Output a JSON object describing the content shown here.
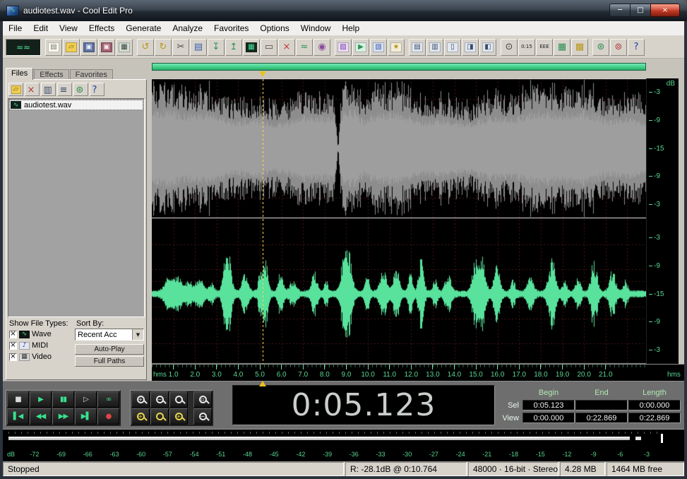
{
  "window": {
    "title": "audiotest.wav - Cool Edit Pro",
    "icon_glyph": "∿",
    "controls": {
      "minimize": "─",
      "maximize": "□",
      "close": "×"
    }
  },
  "menu": {
    "items": [
      "File",
      "Edit",
      "View",
      "Effects",
      "Generate",
      "Analyze",
      "Favorites",
      "Options",
      "Window",
      "Help"
    ]
  },
  "toolbar": {
    "groups": [
      {
        "buttons": [
          {
            "name": "waveform-multitrack-toggle",
            "glyph": "≈≈",
            "fg": "#45e096",
            "bg": "#14211a",
            "fs": 12,
            "wide": true
          }
        ]
      },
      {
        "buttons": [
          {
            "name": "new-file",
            "glyph": "▤",
            "fg": "#77756b",
            "bg": "#fcfcf0"
          },
          {
            "name": "open-file",
            "glyph": "▱",
            "fg": "#7c5f0e",
            "bg": "#f0ce52"
          },
          {
            "name": "save-file",
            "glyph": "▣",
            "fg": "#e8ecf8",
            "bg": "#5e6f9e"
          },
          {
            "name": "save-as-file",
            "glyph": "▣",
            "fg": "#f8e8ec",
            "bg": "#9e5e6f"
          },
          {
            "name": "file-info",
            "glyph": "▦",
            "fg": "#37423a",
            "bg": "#d4ddd4"
          }
        ]
      },
      {
        "buttons": [
          {
            "name": "undo",
            "glyph": "↺",
            "fg": "#b8981c"
          },
          {
            "name": "redo",
            "glyph": "↻",
            "fg": "#b8981c"
          },
          {
            "name": "cut",
            "glyph": "✂",
            "fg": "#4a4a4a"
          },
          {
            "name": "copy",
            "glyph": "▤",
            "fg": "#3a5fae"
          },
          {
            "name": "paste",
            "glyph": "↧",
            "fg": "#2e8f54"
          },
          {
            "name": "paste-to-new",
            "glyph": "↥",
            "fg": "#2e8f54"
          },
          {
            "name": "mix-paste",
            "glyph": "▦",
            "fg": "#45e096",
            "bg": "#142a1c"
          },
          {
            "name": "trim",
            "glyph": "▭",
            "fg": "#4a4a4a"
          },
          {
            "name": "delete-selection",
            "glyph": "×",
            "fg": "#c03a3a"
          },
          {
            "name": "convert-sample-type",
            "glyph": "≈",
            "fg": "#2e8f54"
          },
          {
            "name": "find-beats",
            "glyph": "◉",
            "fg": "#8a4a9e"
          }
        ]
      },
      {
        "buttons": [
          {
            "name": "effects-rack",
            "glyph": "▨",
            "fg": "#7a3fae",
            "bg": "#e9dcf4"
          },
          {
            "name": "preview-play",
            "glyph": "▶",
            "fg": "#2e8f54",
            "bg": "#d9f0e2"
          },
          {
            "name": "batch-scripts",
            "glyph": "▧",
            "fg": "#3a5fae",
            "bg": "#dae2f2"
          },
          {
            "name": "favorites-edit",
            "glyph": "★",
            "fg": "#b8981c",
            "bg": "#f4eed8"
          }
        ]
      },
      {
        "buttons": [
          {
            "name": "cue-list",
            "glyph": "▤",
            "fg": "#3a4a6b",
            "bg": "#e2e8f0"
          },
          {
            "name": "play-list",
            "glyph": "▥",
            "fg": "#3a4a6b",
            "bg": "#e2e8f0"
          },
          {
            "name": "file-info-window",
            "glyph": "▯",
            "fg": "#3a4a6b",
            "bg": "#e2e8f0"
          },
          {
            "name": "cue-organizer",
            "glyph": "◨",
            "fg": "#3a4a6b",
            "bg": "#e2e8f0"
          },
          {
            "name": "phase-analysis",
            "glyph": "◧",
            "fg": "#3a4a6b",
            "bg": "#e2e8f0"
          }
        ]
      },
      {
        "buttons": [
          {
            "name": "frequency-analysis",
            "glyph": "⊙",
            "fg": "#3b3b3b"
          },
          {
            "name": "view-time-window",
            "glyph": "0:15",
            "fg": "#1a1a1a",
            "fs": 7
          },
          {
            "name": "display-time-format",
            "glyph": "EEE",
            "fg": "#1a1a1a",
            "fs": 7
          },
          {
            "name": "spectral-view",
            "glyph": "▦",
            "fg": "#2e8f54"
          },
          {
            "name": "waveform-colors",
            "glyph": "▩",
            "fg": "#b8981c"
          }
        ]
      },
      {
        "buttons": [
          {
            "name": "settings",
            "glyph": "⊛",
            "fg": "#2e8f54"
          },
          {
            "name": "monitor-record-level",
            "glyph": "⊚",
            "fg": "#b03a3a"
          },
          {
            "name": "help",
            "glyph": "?",
            "fg": "#1f3f9e"
          }
        ]
      }
    ]
  },
  "file_panel": {
    "tabs": [
      {
        "label": "Files",
        "active": true
      },
      {
        "label": "Effects",
        "active": false
      },
      {
        "label": "Favorites",
        "active": false
      }
    ],
    "toolbar": [
      {
        "name": "panel-open-file",
        "glyph": "▱",
        "fg": "#7c5f0e",
        "bg": "#f0ce52"
      },
      {
        "name": "panel-close-file",
        "glyph": "×",
        "fg": "#b03a3a"
      },
      {
        "name": "panel-insert-multitrack",
        "glyph": "▥",
        "fg": "#3a4a6b"
      },
      {
        "name": "panel-change-view",
        "glyph": "≡",
        "fg": "#3a4a6b"
      },
      {
        "name": "panel-advanced-options",
        "glyph": "⊛",
        "fg": "#2e8f54"
      },
      {
        "name": "panel-help",
        "glyph": "?",
        "fg": "#1f3f9e"
      }
    ],
    "files": [
      {
        "name": "audiotest.wav",
        "selected": true
      }
    ],
    "show_file_types_label": "Show File Types:",
    "sort_by_label": "Sort By:",
    "checkbox_glyph": "×",
    "file_types": [
      {
        "label": "Wave",
        "checked": true,
        "icon": {
          "glyph": "∿",
          "fg": "#52e09a",
          "bg": "#101614"
        }
      },
      {
        "label": "MIDI",
        "checked": true,
        "icon": {
          "glyph": "♪",
          "fg": "#23409a",
          "bg": "#e4e6f2"
        }
      },
      {
        "label": "Video",
        "checked": true,
        "icon": {
          "glyph": "▦",
          "fg": "#333333",
          "bg": "#d8d8d8"
        }
      }
    ],
    "sort_value": "Recent Acc",
    "sort_dropdown_arrow": "▼",
    "auto_play_label": "Auto-Play",
    "full_paths_label": "Full Paths"
  },
  "waveform": {
    "cursor_seconds": 5.123,
    "view_seconds": 22.869,
    "db_unit": "dB",
    "channel_db_labels": [
      "-3",
      "-9",
      "-15",
      "-9",
      "-3"
    ],
    "timeline": {
      "left_unit": "hms",
      "right_unit": "hms",
      "labels": [
        "1.0",
        "2.0",
        "3.0",
        "4.0",
        "5.0",
        "6.0",
        "7.0",
        "8.0",
        "9.0",
        "10.0",
        "11.0",
        "12.0",
        "13.0",
        "14.0",
        "15.0",
        "16.0",
        "17.0",
        "18.0",
        "19.0",
        "20.0",
        "21.0"
      ]
    }
  },
  "transport": {
    "rows": [
      [
        {
          "name": "stop",
          "glyph": "■",
          "fg": "#d9ddd9"
        },
        {
          "name": "play",
          "glyph": "▶",
          "fg": "#39e08e"
        },
        {
          "name": "pause",
          "glyph": "▮▮",
          "fg": "#39e08e"
        },
        {
          "name": "play-to-end",
          "glyph": "▷",
          "fg": "#d9ddd9"
        },
        {
          "name": "play-looped",
          "glyph": "∞",
          "fg": "#39e08e"
        }
      ],
      [
        {
          "name": "go-to-start",
          "glyph": "▌◀",
          "fg": "#39e08e"
        },
        {
          "name": "rewind",
          "glyph": "◀◀",
          "fg": "#39e08e"
        },
        {
          "name": "fast-forward",
          "glyph": "▶▶",
          "fg": "#39e08e"
        },
        {
          "name": "go-to-end",
          "glyph": "▶▌",
          "fg": "#39e08e"
        },
        {
          "name": "record",
          "glyph": "●",
          "fg": "#e04545"
        }
      ]
    ]
  },
  "zoom": {
    "rows": [
      [
        {
          "name": "zoom-in",
          "glyph": "+",
          "color": "#e6e6e6"
        },
        {
          "name": "zoom-out",
          "glyph": "−",
          "color": "#e6e6e6"
        },
        {
          "name": "zoom-full",
          "glyph": "",
          "color": "#e6e6e6"
        },
        {
          "name": "zoom-to-selection",
          "glyph": "▫",
          "color": "#e6e6e6"
        }
      ],
      [
        {
          "name": "zoom-sel-left",
          "glyph": "+",
          "color": "#e8d44a"
        },
        {
          "name": "zoom-sel",
          "glyph": "",
          "color": "#e8d44a"
        },
        {
          "name": "zoom-sel-right",
          "glyph": "+",
          "color": "#e8d44a"
        },
        {
          "name": "zoom-out-vertical",
          "glyph": "−",
          "color": "#e6e6e6"
        }
      ]
    ]
  },
  "time_display": {
    "value": "0:05.123"
  },
  "selection_view": {
    "headers": [
      "Begin",
      "End",
      "Length"
    ],
    "rows": [
      {
        "label": "Sel",
        "values": [
          "0:05.123",
          "",
          "0:00.000"
        ]
      },
      {
        "label": "View",
        "values": [
          "0:00.000",
          "0:22.869",
          "0:22.869"
        ]
      }
    ]
  },
  "level_meter": {
    "unit": "dB",
    "labels": [
      "-72",
      "-69",
      "-66",
      "-63",
      "-60",
      "-57",
      "-54",
      "-51",
      "-48",
      "-45",
      "-42",
      "-39",
      "-36",
      "-33",
      "-30",
      "-27",
      "-24",
      "-21",
      "-18",
      "-15",
      "-12",
      "-9",
      "-6",
      "-3"
    ]
  },
  "status_bar": {
    "mode": "Stopped",
    "record_peak": "R: -28.1dB @ 0:10.764",
    "format": "48000 · 16-bit · Stereo",
    "file_size": "4.28 MB",
    "free_space": "1464 MB free"
  },
  "colors": {
    "waveform_green": "#58e29c",
    "waveform_gray": "#8d8d8d",
    "ruler_green": "#5ad793",
    "cursor_yellow": "#ffd84d",
    "marker_yellow": "#e8c123"
  }
}
